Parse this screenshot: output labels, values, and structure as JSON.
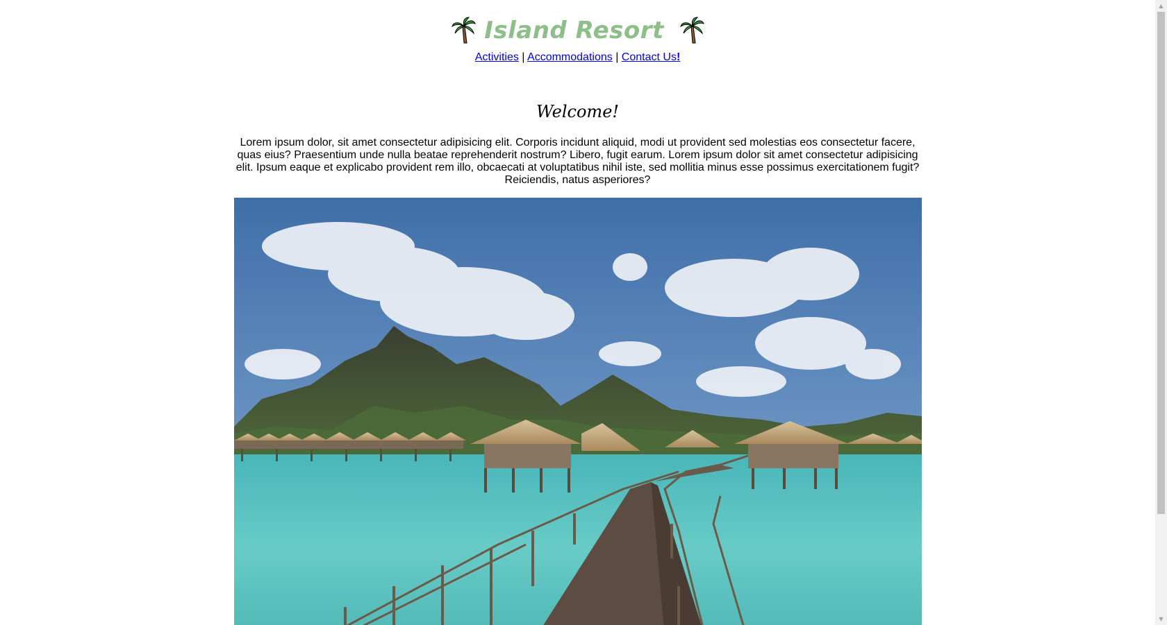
{
  "header": {
    "title": "Island Resort",
    "left_icon": "palm-tree-icon",
    "right_icon": "palm-tree-icon",
    "title_color": "#8fbf88"
  },
  "nav": {
    "links": [
      {
        "label": "Activities"
      },
      {
        "label": "Accommodations"
      },
      {
        "label": "Contact Us"
      }
    ],
    "separator": "|",
    "contact_suffix": "!"
  },
  "main": {
    "heading": "Welcome!",
    "intro": "Lorem ipsum dolor, sit amet consectetur adipisicing elit. Corporis incidunt aliquid, modi ut provident sed molestias eos consectetur facere, quas eius? Praesentium unde nulla beatae reprehenderit nostrum? Libero, fugit earum. Lorem ipsum dolor sit amet consectetur adipisicing elit. Ipsum eaque et explicabo provident rem illo, obcaecati at voluptatibus nihil iste, sed mollitia minus esse possimus exercitationem fugit? Reiciendis, natus asperiores?",
    "hero_image": "overwater-bungalows-photo"
  },
  "colors": {
    "link": "#0000ee",
    "sky": "#4f7fb8",
    "lagoon": "#5fc6c4",
    "thatch": "#c9ad82",
    "mountain": "#3f4a32",
    "boardwalk": "#5a4a40"
  }
}
